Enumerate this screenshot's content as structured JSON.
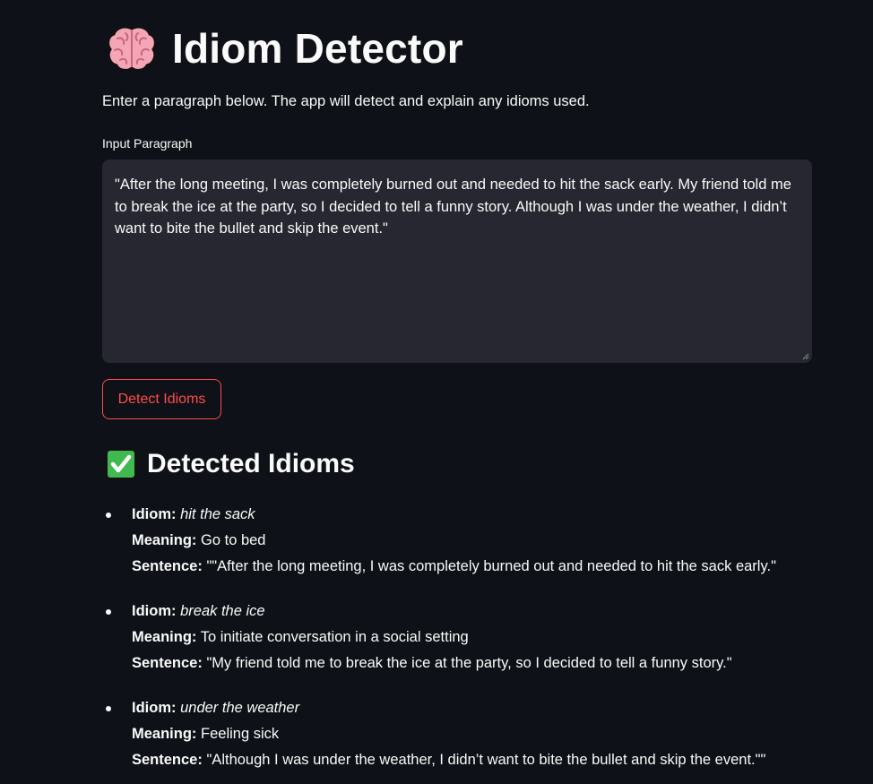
{
  "app": {
    "title": "Idiom Detector",
    "title_icon": "brain-icon",
    "intro": "Enter a paragraph below. The app will detect and explain any idioms used."
  },
  "input": {
    "label": "Input Paragraph",
    "value": "\"After the long meeting, I was completely burned out and needed to hit the sack early. My friend told me to break the ice at the party, so I decided to tell a funny story. Although I was under the weather, I didn’t want to bite the bullet and skip the event.\""
  },
  "button": {
    "detect_label": "Detect Idioms",
    "accent_color": "#ff4b4b"
  },
  "results": {
    "icon": "check-mark-icon",
    "heading": "Detected Idioms",
    "idiom_label": "Idiom:",
    "meaning_label": "Meaning:",
    "sentence_label": "Sentence:",
    "items": [
      {
        "idiom": "hit the sack",
        "meaning": "Go to bed",
        "sentence": "\"\"After the long meeting, I was completely burned out and needed to hit the sack early.\""
      },
      {
        "idiom": "break the ice",
        "meaning": "To initiate conversation in a social setting",
        "sentence": "\"My friend told me to break the ice at the party, so I decided to tell a funny story.\""
      },
      {
        "idiom": "under the weather",
        "meaning": "Feeling sick",
        "sentence": "\"Although I was under the weather, I didn’t want to bite the bullet and skip the event.\"\""
      }
    ]
  },
  "colors": {
    "background": "#0e1117",
    "input_background": "#262730",
    "text": "#fafafa"
  }
}
